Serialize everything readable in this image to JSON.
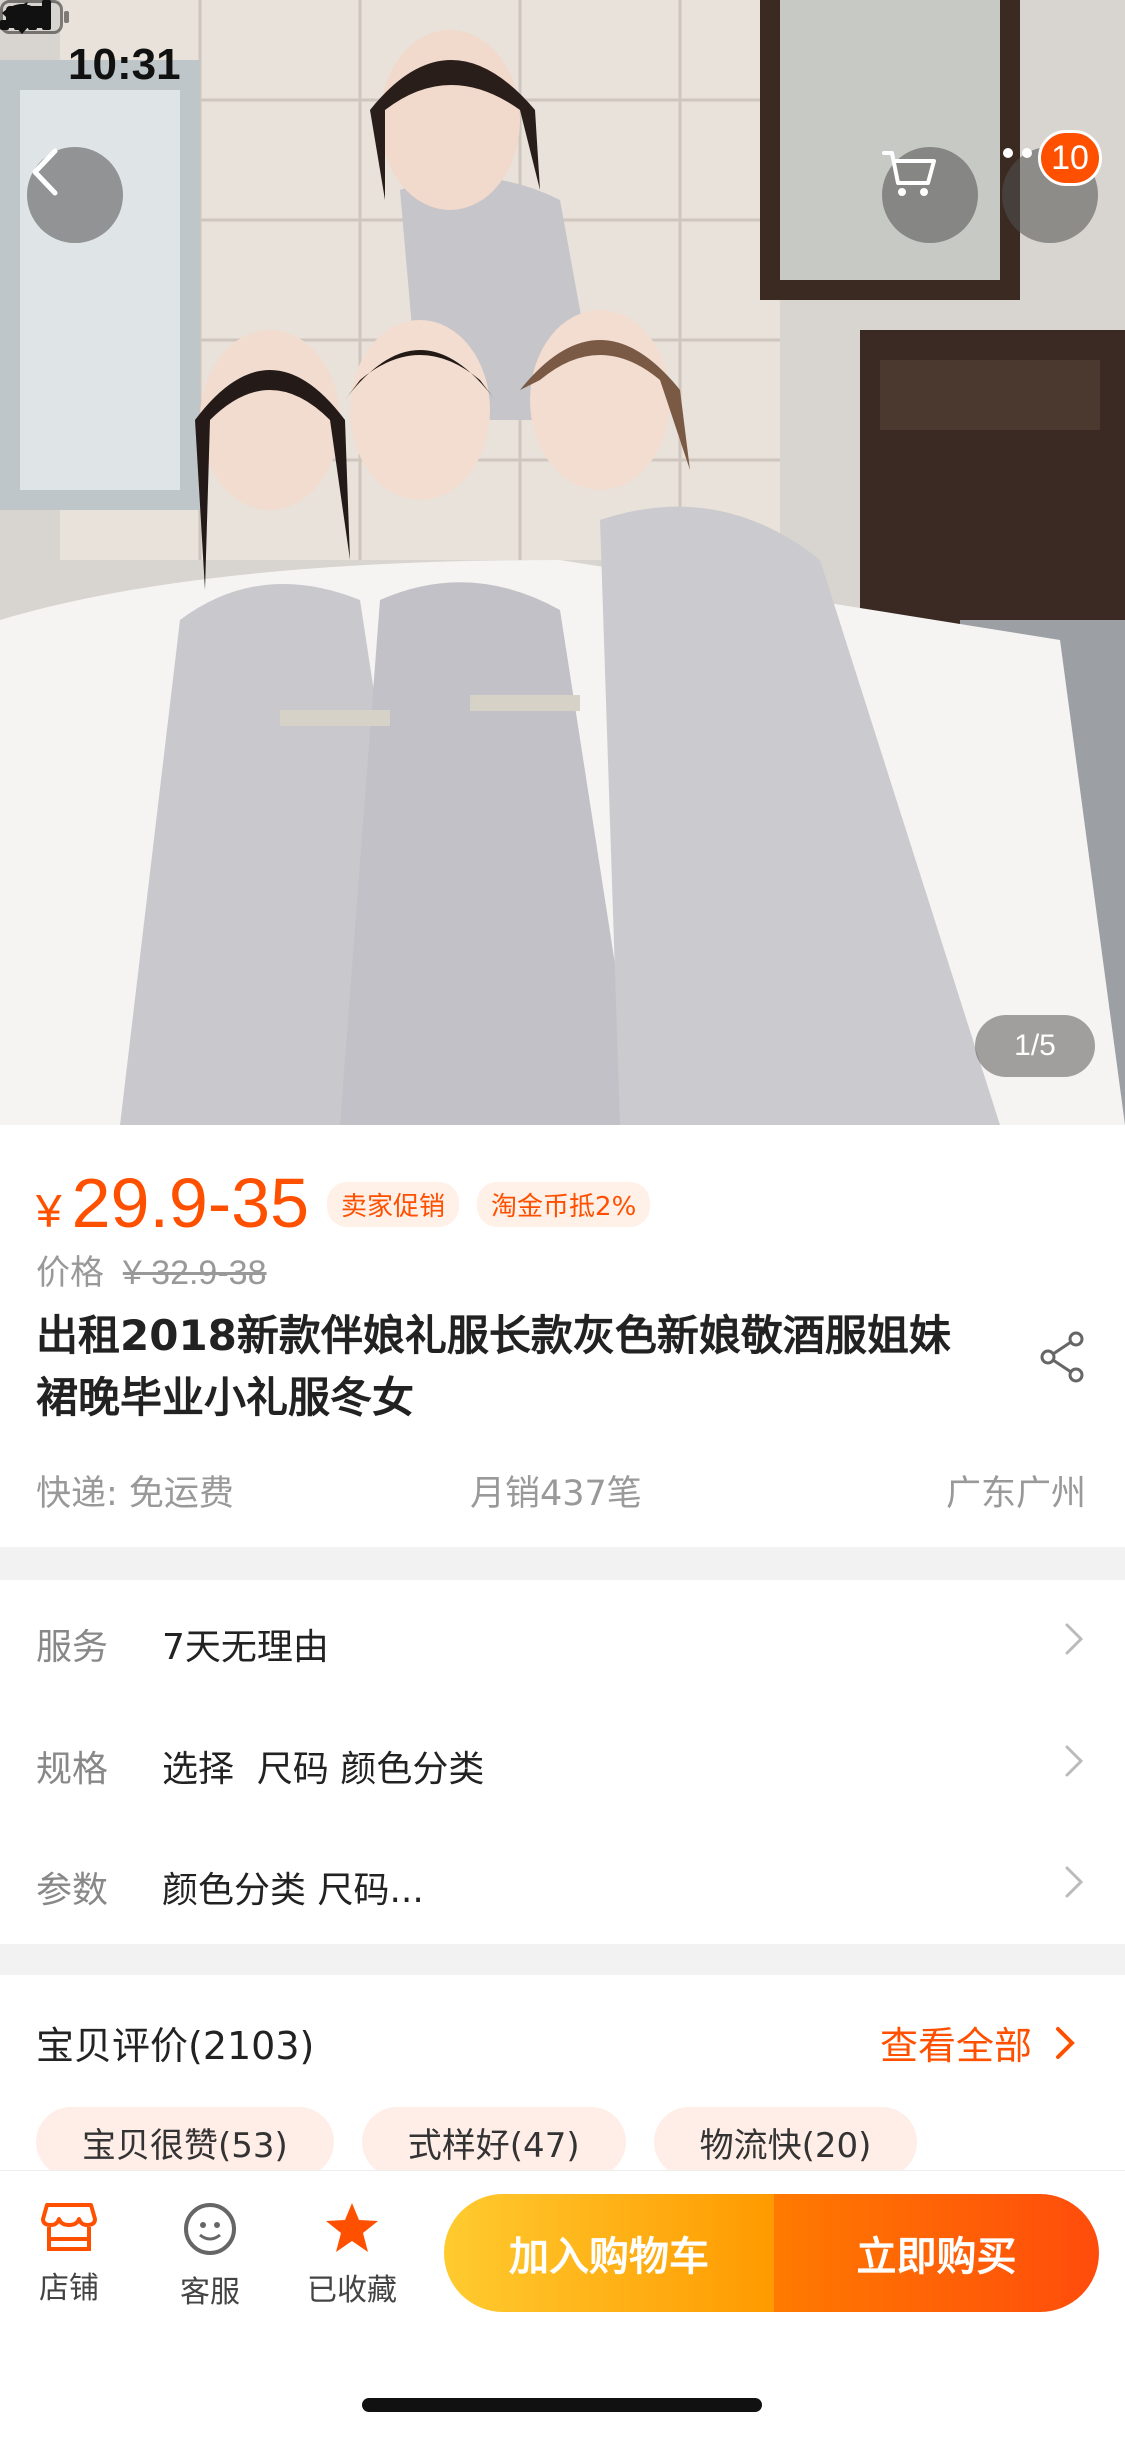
{
  "status_bar": {
    "time": "10:31"
  },
  "hero": {
    "image_counter": "1/5",
    "cart_badge_count": "10",
    "image_alt": "photo-bridesmaids-grey-dresses"
  },
  "product": {
    "currency": "¥",
    "price": "29.9-35",
    "tags": [
      "卖家促销",
      "淘金币抵2%"
    ],
    "original_price_label": "价格",
    "original_price": "¥ 32.9-38",
    "title": "出租2018新款伴娘礼服长款灰色新娘敬酒服姐妹裙晚毕业小礼服冬女",
    "shipping": "快递: 免运费",
    "monthly_sales": "月销437笔",
    "location": "广东广州"
  },
  "options": [
    {
      "label": "服务",
      "value": "7天无理由"
    },
    {
      "label": "规格",
      "value": "选择  尺码 颜色分类"
    },
    {
      "label": "参数",
      "value": "颜色分类 尺码..."
    }
  ],
  "reviews": {
    "title": "宝贝评价(2103)",
    "view_all": "查看全部",
    "tags": [
      "宝贝很赞(53)",
      "式样好(47)",
      "物流快(20)"
    ]
  },
  "bottom_bar": {
    "store": "店铺",
    "service": "客服",
    "favorited": "已收藏",
    "add_to_cart": "加入购物车",
    "buy_now": "立即购买"
  },
  "colors": {
    "accent": "#ff5000",
    "cart_button": "#ffb300",
    "buy_button": "#ff5a0a"
  }
}
